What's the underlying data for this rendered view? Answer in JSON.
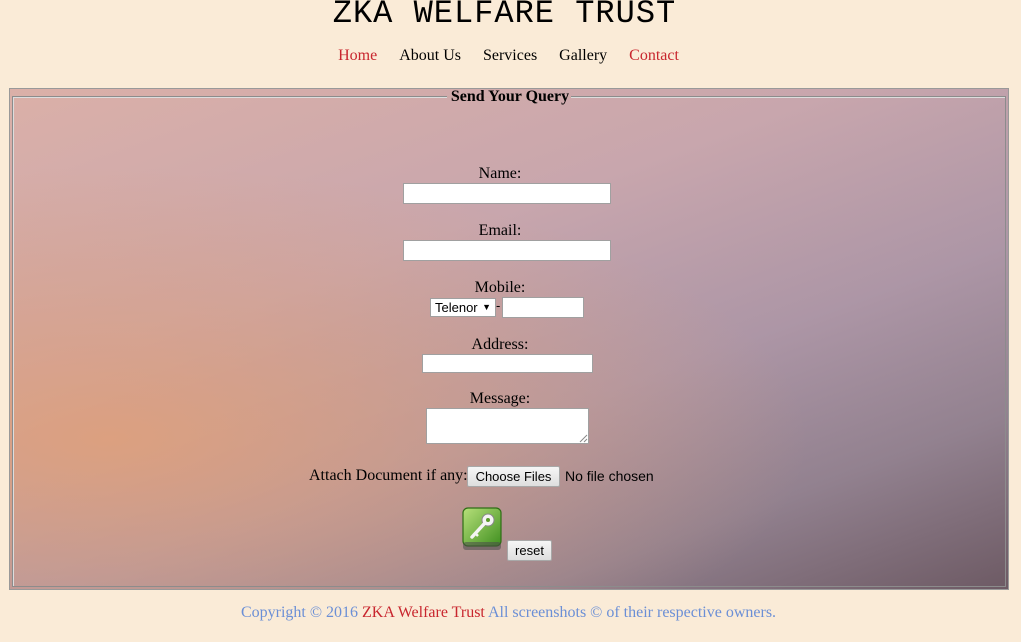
{
  "site": {
    "title": "ZKA WELFARE TRUST"
  },
  "nav": {
    "items": [
      {
        "label": "Home",
        "active": true
      },
      {
        "label": "About Us"
      },
      {
        "label": "Services"
      },
      {
        "label": "Gallery"
      },
      {
        "label": "Contact",
        "active": true
      }
    ]
  },
  "form": {
    "legend": "Send Your Query",
    "name_label": "Name:",
    "name_value": "",
    "email_label": "Email:",
    "email_value": "",
    "mobile_label": "Mobile:",
    "mobile_network": "Telenor",
    "mobile_separator": "-",
    "mobile_number": "",
    "address_label": "Address:",
    "address_value": "",
    "message_label": "Message:",
    "message_value": "",
    "attach_label": "Attach Document if any:",
    "choose_files_label": "Choose Files",
    "no_file_text": "No file chosen",
    "reset_label": "reset",
    "submit_icon": "key-icon"
  },
  "footer": {
    "prefix": "Copyright © 2016 ",
    "brand": "ZKA Welfare Trust",
    "suffix": " All screenshots © of their respective owners."
  },
  "colors": {
    "page_background": "#faebd7",
    "nav_active": "#c8262e",
    "footer_text": "#6b8fd6"
  }
}
